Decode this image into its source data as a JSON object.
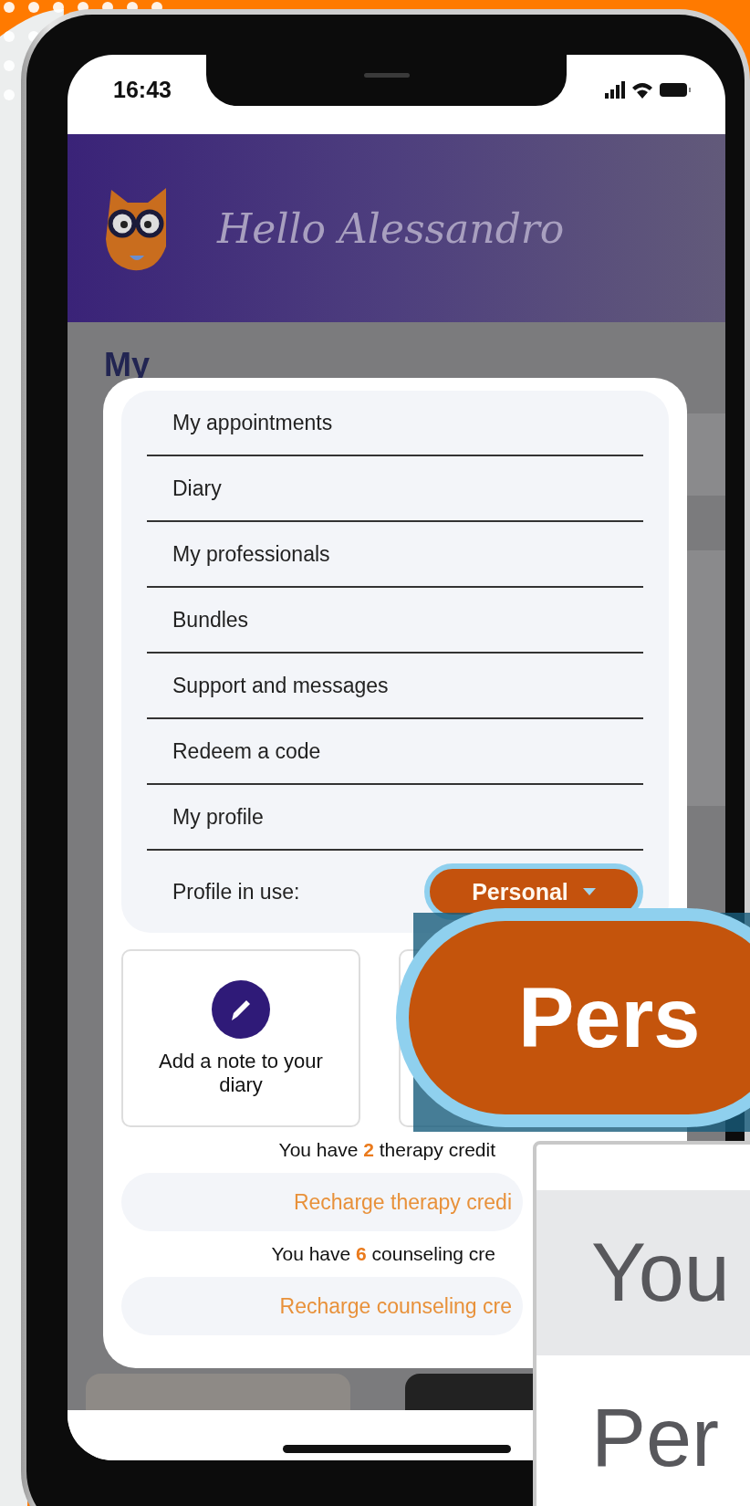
{
  "status_bar": {
    "time": "16:43"
  },
  "header": {
    "greeting": "Hello Alessandro"
  },
  "background_heading": "My",
  "menu": {
    "items": [
      "My appointments",
      "Diary",
      "My professionals",
      "Bundles",
      "Support and messages",
      "Redeem a code",
      "My profile"
    ],
    "profile_label": "Profile in use:",
    "profile_value": "Personal"
  },
  "actions": [
    {
      "kind": "note",
      "label": "Add a note to your diary"
    },
    {
      "kind": "empty"
    }
  ],
  "credits": [
    {
      "text": "You have **2** therapy credit",
      "button": "Recharge therapy credi"
    },
    {
      "text": "You have **6** counseling cre",
      "button": "Recharge counseling cre"
    }
  ],
  "magnifier": {
    "text": "Pers"
  },
  "zoom_panel": {
    "lines": [
      "You",
      "Per"
    ]
  }
}
